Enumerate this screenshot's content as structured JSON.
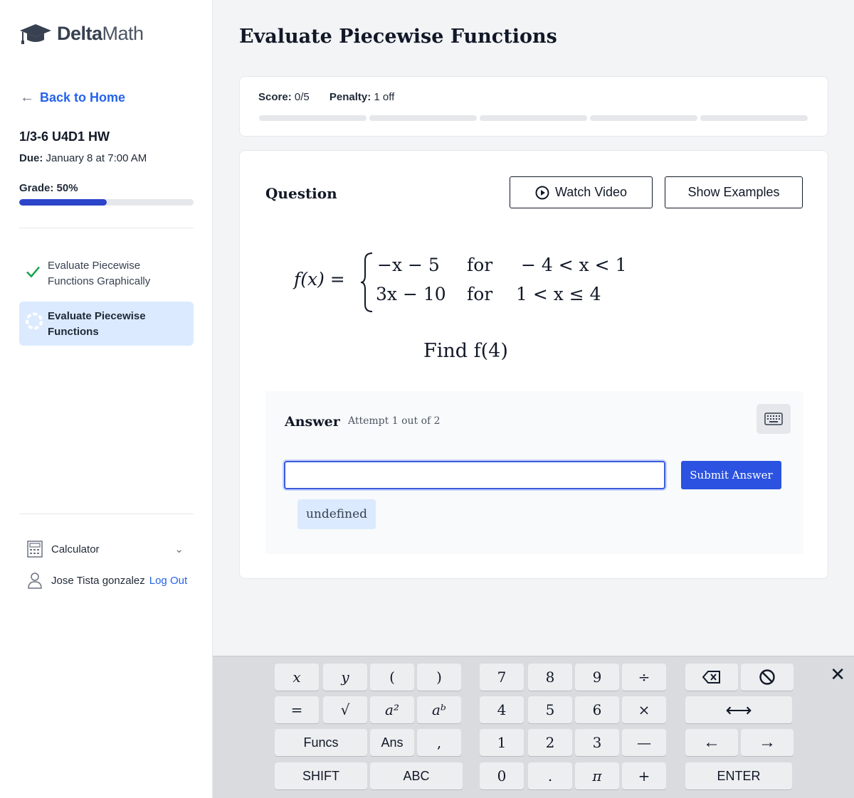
{
  "sidebar": {
    "logo": {
      "bold": "Delta",
      "rest": "Math"
    },
    "back_label": "Back to Home",
    "assignment_title": "1/3-6 U4D1 HW",
    "due_label": "Due:",
    "due_value": "January 8 at 7:00 AM",
    "grade_label": "Grade:",
    "grade_value": "50%",
    "grade_fraction": 0.5,
    "tasks": [
      {
        "line1": "Evaluate Piecewise",
        "line2": "Functions Graphically",
        "status": "complete"
      },
      {
        "line1": "Evaluate Piecewise",
        "line2": "Functions",
        "status": "in-progress"
      }
    ],
    "calculator_label": "Calculator",
    "user_name": "Jose Tista gonzalez",
    "logout_label": "Log Out"
  },
  "main": {
    "title": "Evaluate Piecewise Functions",
    "score_label": "Score:",
    "score_value": "0/5",
    "penalty_label": "Penalty:",
    "penalty_value": "1 off",
    "question_label": "Question",
    "watch_video_label": "Watch Video",
    "show_examples_label": "Show Examples",
    "function_name": "f(x) =",
    "cases": [
      {
        "expr": "−x − 5",
        "cond_word": "for",
        "cond": "− 4 < x < 1"
      },
      {
        "expr": "3x − 10",
        "cond_word": "for",
        "cond": "1 < x ≤ 4"
      }
    ],
    "prompt": "Find f(4)",
    "answer_label": "Answer",
    "attempt_text": "Attempt 1 out of 2",
    "answer_value": "",
    "submit_label": "Submit Answer",
    "suggestion_chip": "undefined"
  },
  "keyboard": {
    "row1": [
      "x",
      "y",
      "(",
      ")",
      "7",
      "8",
      "9",
      "÷"
    ],
    "row2": [
      "=",
      "√",
      "a²",
      "aᵇ",
      "4",
      "5",
      "6",
      "×"
    ],
    "row3": [
      "Funcs",
      "Ans",
      ",",
      "1",
      "2",
      "3",
      "—"
    ],
    "row4": [
      "SHIFT",
      "ABC",
      "0",
      ".",
      "π",
      "+"
    ],
    "enter_label": "ENTER",
    "close_symbol": "✕",
    "icons": [
      "backspace-icon",
      "clear-icon",
      "arrows-horizontal-icon",
      "arrow-left-icon",
      "arrow-right-icon"
    ]
  },
  "colors": {
    "accent": "#2b52e0",
    "link": "#2563eb",
    "active_bg": "#dbeafe",
    "check": "#16a34a"
  }
}
